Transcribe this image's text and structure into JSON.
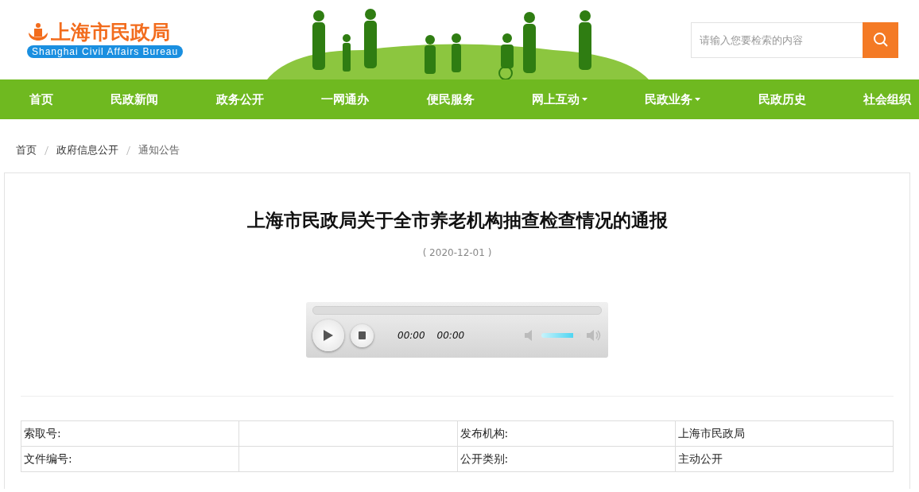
{
  "logo": {
    "name": "上海市民政局",
    "subtitle": "Shanghai Civil Affairs Bureau"
  },
  "search": {
    "placeholder": "请输入您要检索的内容"
  },
  "nav": [
    {
      "label": "首页",
      "dropdown": false
    },
    {
      "label": "民政新闻",
      "dropdown": false
    },
    {
      "label": "政务公开",
      "dropdown": false
    },
    {
      "label": "一网通办",
      "dropdown": false
    },
    {
      "label": "便民服务",
      "dropdown": false
    },
    {
      "label": "网上互动",
      "dropdown": true
    },
    {
      "label": "民政业务",
      "dropdown": true
    },
    {
      "label": "民政历史",
      "dropdown": false
    },
    {
      "label": "社会组织",
      "dropdown": false
    }
  ],
  "breadcrumb": [
    "首页",
    "政府信息公开",
    "通知公告"
  ],
  "article": {
    "title": "上海市民政局关于全市养老机构抽查检查情况的通报",
    "date": "( 2020-12-01 )"
  },
  "player": {
    "current_time": "00:00",
    "duration": "00:00",
    "volume": {
      "level": 0.8
    }
  },
  "info_table": {
    "rows": [
      [
        "索取号:",
        "",
        "发布机构:",
        "上海市民政局"
      ],
      [
        "文件编号:",
        "",
        "公开类别:",
        "主动公开"
      ]
    ]
  }
}
